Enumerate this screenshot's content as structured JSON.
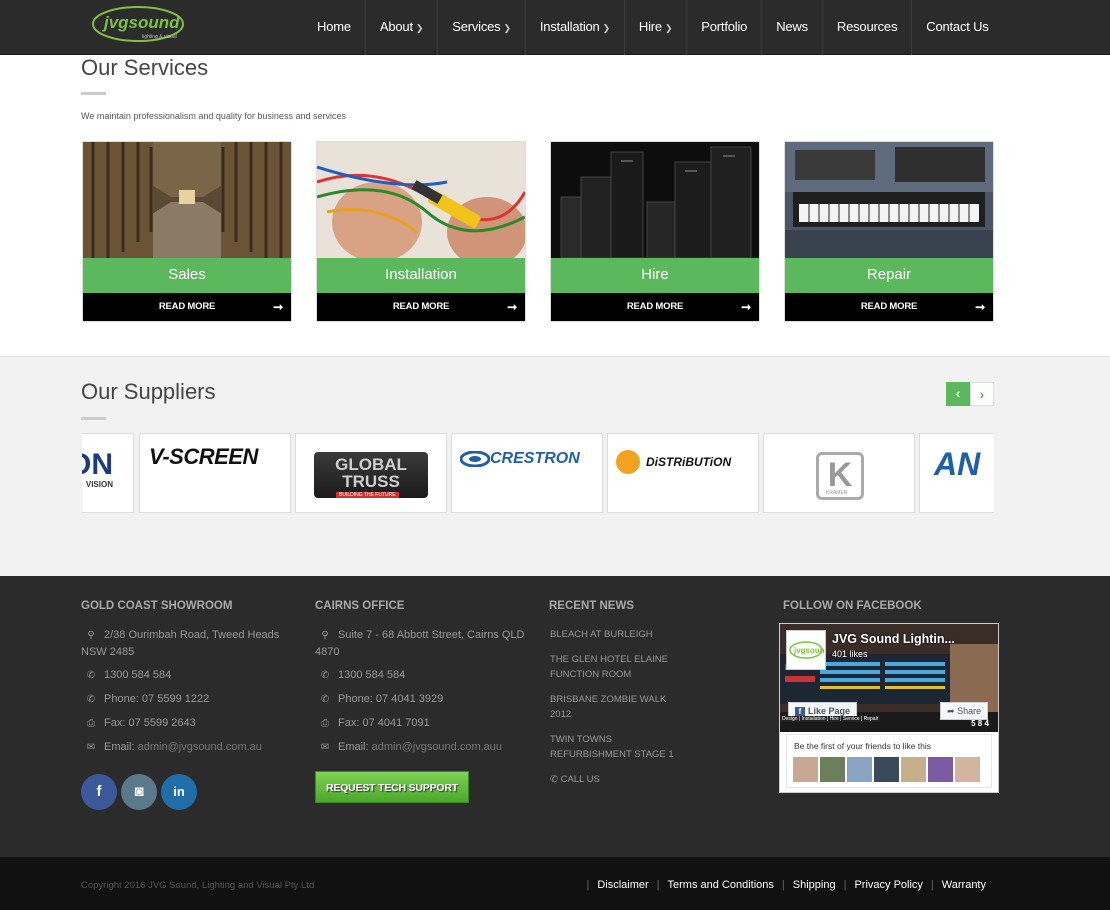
{
  "nav": {
    "logo_text": "jvgsound",
    "logo_sub": "lighting & visual",
    "items": [
      {
        "label": "Home",
        "has_dropdown": false
      },
      {
        "label": "About",
        "has_dropdown": true
      },
      {
        "label": "Services",
        "has_dropdown": true
      },
      {
        "label": "Installation",
        "has_dropdown": true
      },
      {
        "label": "Hire",
        "has_dropdown": true
      },
      {
        "label": "Portfolio",
        "has_dropdown": false
      },
      {
        "label": "News",
        "has_dropdown": false
      },
      {
        "label": "Resources",
        "has_dropdown": false
      },
      {
        "label": "Contact Us",
        "has_dropdown": false
      }
    ]
  },
  "services": {
    "title": "Our Services",
    "subtitle": "We maintain professionalism and quality for business and services",
    "cards": [
      {
        "label": "Sales",
        "read_more": "READ MORE",
        "image": "corridor-photo"
      },
      {
        "label": "Installation",
        "read_more": "READ MORE",
        "image": "wiring-photo"
      },
      {
        "label": "Hire",
        "read_more": "READ MORE",
        "image": "speakers-photo"
      },
      {
        "label": "Repair",
        "read_more": "READ MORE",
        "image": "keyboard-photo"
      }
    ]
  },
  "suppliers": {
    "title": "Our Suppliers",
    "prev_icon": "chevron-left-icon",
    "next_icon": "chevron-right-icon",
    "logos": [
      {
        "name": "ON",
        "sub": "VISION"
      },
      {
        "name": "V-SCREEN"
      },
      {
        "name": "GLOBAL TRUSS",
        "sub": "BUILDING THE FUTURE"
      },
      {
        "name": "CRESTRON"
      },
      {
        "name": "DiSTRiBUTiON"
      },
      {
        "name": "K",
        "sub": "KRAMER"
      },
      {
        "name": "AN"
      }
    ]
  },
  "footer": {
    "gold_coast": {
      "title": "GOLD COAST SHOWROOM",
      "address": "2/38 Ourimbah Road, Tweed Heads NSW 2485",
      "phone1": "1300 584 584",
      "phone2": "Phone: 07 5599 1222",
      "fax": "Fax: 07 5599 2643",
      "email_label": "Email:",
      "email": "admin@jvgsound.com.au"
    },
    "cairns": {
      "title": "CAIRNS OFFICE",
      "address": "Suite 7 - 68 Abbott Street, Cairns QLD 4870",
      "phone1": "1300 584 584",
      "phone2": "Phone: 07 4041 3929",
      "fax": "Fax: 07 4041 7091",
      "email_label": "Email:",
      "email": "admin@jvgsound.com.auu",
      "support_button": "REQUEST TECH SUPPORT"
    },
    "news": {
      "title": "RECENT NEWS",
      "items": [
        "BLEACH AT BURLEIGH",
        "THE GLEN HOTEL ELAINE FUNCTION ROOM",
        "BRISBANE ZOMBIE WALK 2012",
        "TWIN TOWNS REFURBISHMENT STAGE 1"
      ],
      "call_us": "CALL US"
    },
    "facebook": {
      "title": "FOLLOW ON FACEBOOK",
      "page_name": "JVG Sound Lightin...",
      "likes": "401 likes",
      "like_button": "Like Page",
      "share_button": "Share",
      "caption": "Design | Installation | Hire | Service | Repair",
      "friends_text": "Be the first of your friends to like this",
      "cover_number": "5 8 4"
    },
    "social": [
      {
        "icon": "facebook-icon",
        "glyph": "f",
        "color": "#3b5998"
      },
      {
        "icon": "instagram-icon",
        "glyph": "◙",
        "color": "#5a7a8c"
      },
      {
        "icon": "linkedin-icon",
        "glyph": "in",
        "color": "#1f6ea8"
      }
    ]
  },
  "bottom": {
    "copyright": "Copyright 2016 JVG Sound, Lighting and Visual Pty Ltd",
    "links": [
      "Disclaimer",
      "Terms and Conditions",
      "Shipping",
      "Privacy Policy",
      "Warranty"
    ]
  },
  "colors": {
    "accent": "#5cb85c",
    "nav_bg": "#2b2b2b",
    "footer_bg": "#2b2b2b",
    "bottom_bg": "#111111"
  }
}
